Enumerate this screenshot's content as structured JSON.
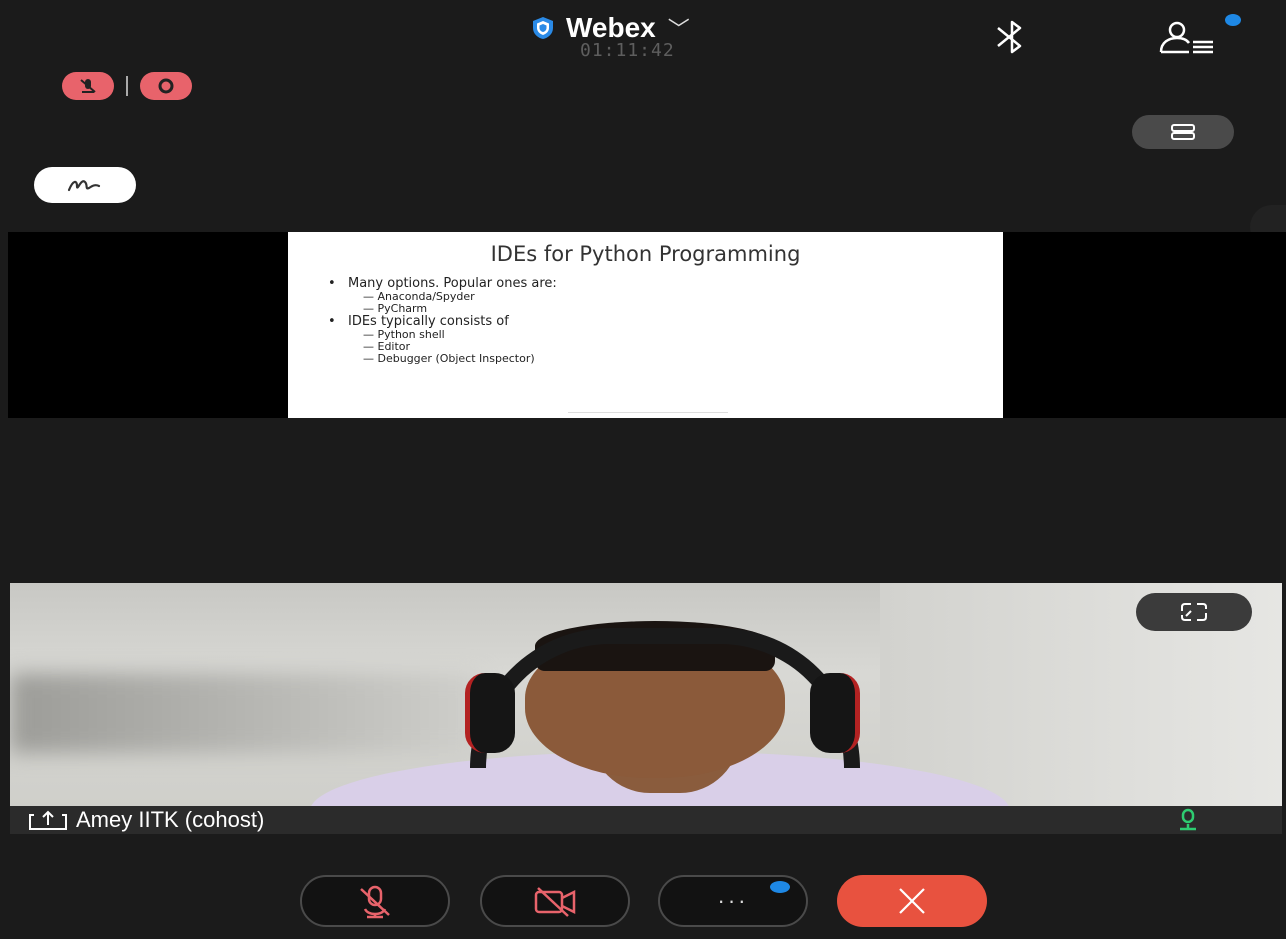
{
  "header": {
    "app_name": "Webex",
    "timer": "01:11:42"
  },
  "slide": {
    "title": "IDEs for Python Programming",
    "bullets": [
      {
        "text": "Many options. Popular ones are:",
        "subs": [
          "Anaconda/Spyder",
          "PyCharm"
        ]
      },
      {
        "text": "IDEs typically consists of",
        "subs": [
          "Python shell",
          "Editor",
          "Debugger (Object Inspector)"
        ]
      }
    ]
  },
  "video": {
    "participant_name": "Amey IITK (cohost)"
  },
  "colors": {
    "accent_blue": "#1e88e5",
    "leave_red": "#e8523f",
    "status_red": "#e8636b",
    "mic_green": "#2ecc71"
  },
  "icons": {
    "shield": "shield-icon",
    "bluetooth": "bluetooth-icon",
    "participants": "participants-icon",
    "layout": "layout-icon",
    "annotate": "annotate-icon",
    "expand": "expand-icon",
    "share": "share-icon",
    "mic": "microphone-icon",
    "video_off": "video-off-icon",
    "more": "more-icon",
    "leave": "leave-icon"
  }
}
